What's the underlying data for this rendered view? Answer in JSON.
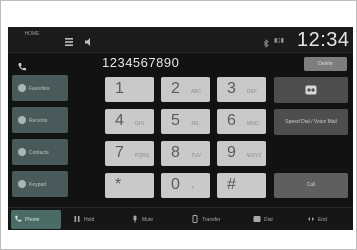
{
  "status": {
    "home_label": "HOME",
    "clock": "12:34",
    "signal_text": "▮▯▮"
  },
  "dialer": {
    "number": "1234567890",
    "delete_label": "Delete"
  },
  "side_menu": [
    {
      "label": "Favorites",
      "icon": "star-icon"
    },
    {
      "label": "Recents",
      "icon": "clock-icon"
    },
    {
      "label": "Contacts",
      "icon": "contacts-icon"
    },
    {
      "label": "Keypad",
      "icon": "keypad-icon"
    }
  ],
  "keys": [
    {
      "digit": "1",
      "letters": ""
    },
    {
      "digit": "2",
      "letters": "ABC"
    },
    {
      "digit": "3",
      "letters": "DEF"
    },
    {
      "digit": "4",
      "letters": "GHI"
    },
    {
      "digit": "5",
      "letters": "JKL"
    },
    {
      "digit": "6",
      "letters": "MNO"
    },
    {
      "digit": "7",
      "letters": "PQRS"
    },
    {
      "digit": "8",
      "letters": "TUV"
    },
    {
      "digit": "9",
      "letters": "WXYZ"
    },
    {
      "digit": "*",
      "letters": ""
    },
    {
      "digit": "0",
      "letters": "+"
    },
    {
      "digit": "#",
      "letters": ""
    }
  ],
  "right_buttons": {
    "voicemail_label": "",
    "speed_dial_label": "Speed Dial / Voice Mail",
    "call_label": "Call"
  },
  "bottom_bar": [
    {
      "label": "Phone",
      "icon": "phone-icon"
    },
    {
      "label": "Hold",
      "icon": "hold-icon"
    },
    {
      "label": "Mute",
      "icon": "mute-icon"
    },
    {
      "label": "Transfer",
      "icon": "transfer-icon"
    },
    {
      "label": "Dial",
      "icon": "dial-icon"
    },
    {
      "label": "End",
      "icon": "end-icon"
    }
  ]
}
